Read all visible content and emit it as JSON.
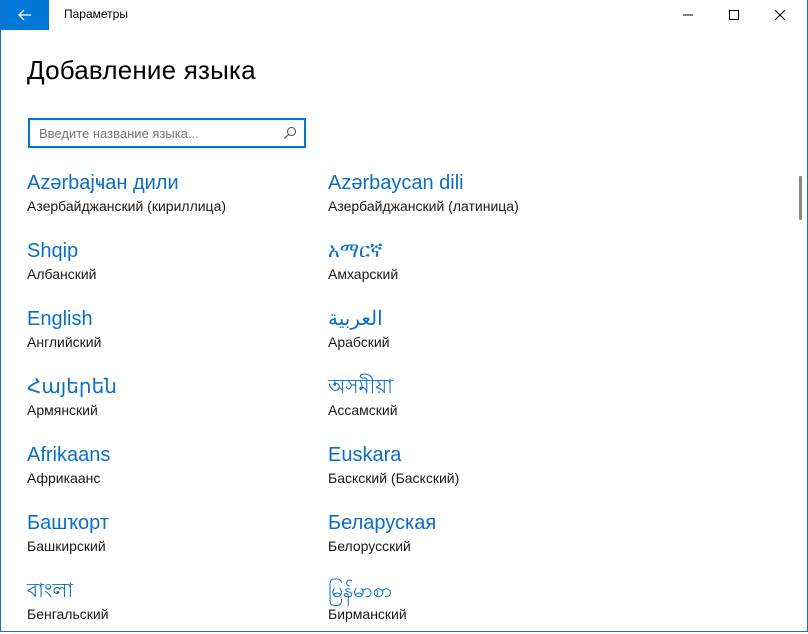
{
  "window": {
    "title": "Параметры"
  },
  "page": {
    "title": "Добавление языка"
  },
  "search": {
    "placeholder": "Введите название языка...",
    "value": ""
  },
  "languages": [
    {
      "native": "Azərbaјҹан дили",
      "russian": "Азербайджанский (кириллица)"
    },
    {
      "native": "Azərbaycan dili",
      "russian": "Азербайджанский (латиница)"
    },
    {
      "native": "Shqip",
      "russian": "Албанский"
    },
    {
      "native": "አማርኛ",
      "russian": "Амхарский"
    },
    {
      "native": "English",
      "russian": "Английский"
    },
    {
      "native": "العربية",
      "russian": "Арабский"
    },
    {
      "native": "Հայերեն",
      "russian": "Армянский"
    },
    {
      "native": "অসমীয়া",
      "russian": "Ассамский"
    },
    {
      "native": "Afrikaans",
      "russian": "Африкаанс"
    },
    {
      "native": "Euskara",
      "russian": "Баскский (Баскский)"
    },
    {
      "native": "Башҡорт",
      "russian": "Башкирский"
    },
    {
      "native": "Беларуская",
      "russian": "Белорусский"
    },
    {
      "native": "বাংলা",
      "russian": "Бенгальский"
    },
    {
      "native": "မြန်မာစာ",
      "russian": "Бирманский"
    }
  ],
  "colors": {
    "accent": "#0078d7",
    "link": "#0a6fc2"
  },
  "icons": {
    "back": "back-arrow-icon",
    "search": "search-icon",
    "minimize": "minimize-icon",
    "maximize": "maximize-icon",
    "close": "close-icon"
  }
}
